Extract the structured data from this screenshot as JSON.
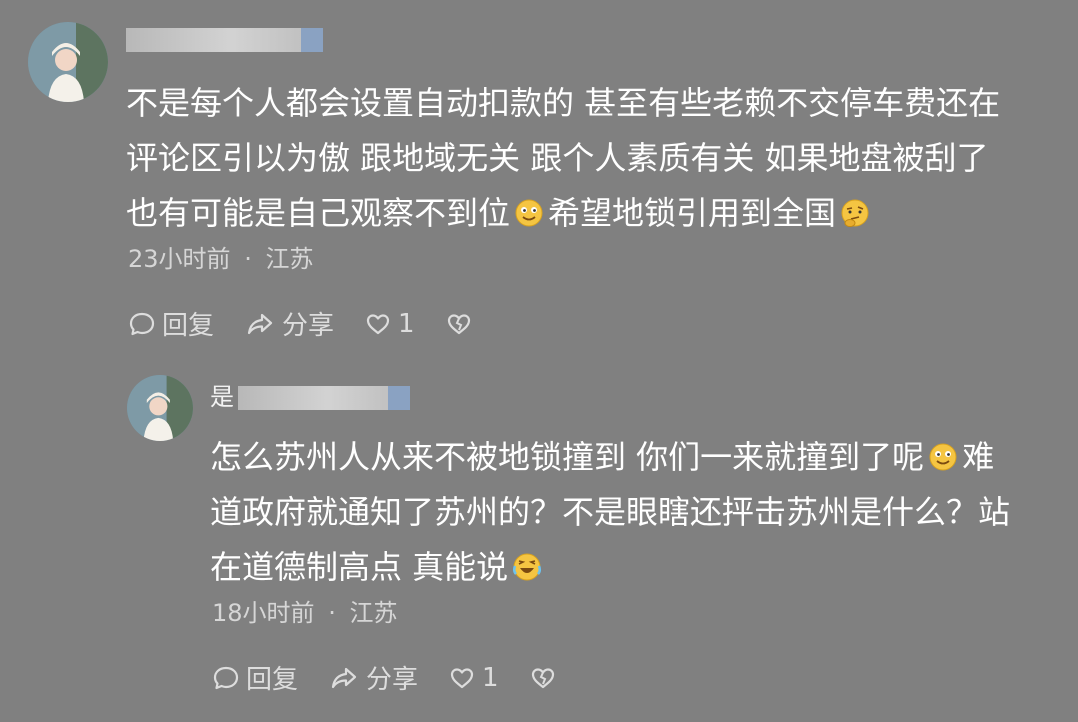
{
  "comments": [
    {
      "username_prefix": "",
      "lines": [
        "不是每个人都会设置自动扣款的 甚至有些老赖不交停车费还在",
        "评论区引以为傲 跟地域无关 跟个人素质有关 如果地盘被刮了",
        "也有可能是自己观察不到位",
        "希望地锁引用到全国"
      ],
      "time": "23小时前",
      "location": "江苏",
      "reply_label": "回复",
      "share_label": "分享",
      "like_count": "1"
    },
    {
      "username_prefix": "是",
      "lines": [
        "怎么苏州人从来不被地锁撞到 你们一来就撞到了呢",
        "难",
        "道政府就通知了苏州的？不是眼瞎还抨击苏州是什么？站",
        "在道德制高点 真能说"
      ],
      "time": "18小时前",
      "location": "江苏",
      "reply_label": "回复",
      "share_label": "分享",
      "like_count": "1"
    }
  ],
  "separator": "·",
  "icons": {
    "reply": "speech-bubble-icon",
    "share": "share-arrow-icon",
    "like": "heart-icon",
    "dislike": "broken-heart-icon",
    "emoji_smile": "smile-emoji-icon",
    "emoji_thinking": "thinking-emoji-icon",
    "emoji_laugh": "laughing-emoji-icon"
  },
  "colors": {
    "background": "#808080",
    "text": "#ffffff",
    "meta": "#d6d6d6"
  }
}
